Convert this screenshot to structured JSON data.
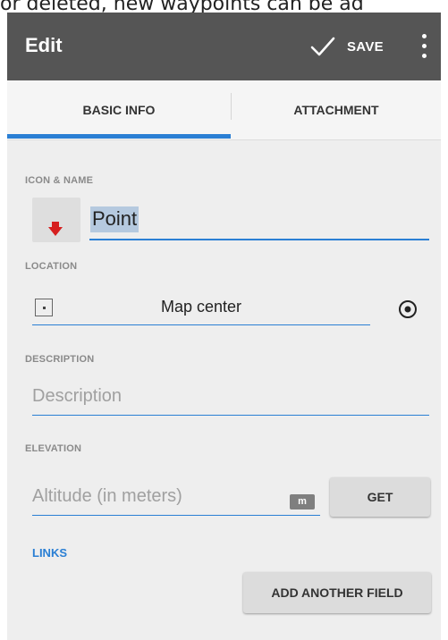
{
  "caption": "or deleted, new waypoints can be ad",
  "toolbar": {
    "title": "Edit",
    "save_label": "SAVE"
  },
  "tabs": [
    {
      "label": "BASIC INFO",
      "active": true
    },
    {
      "label": "ATTACHMENT",
      "active": false
    }
  ],
  "form": {
    "icon_name_label": "ICON & NAME",
    "name_value": "Point",
    "location_label": "LOCATION",
    "location_value": "Map center",
    "description_label": "DESCRIPTION",
    "description_placeholder": "Description",
    "elevation_label": "ELEVATION",
    "elevation_placeholder": "Altitude (in meters)",
    "elevation_unit": "m",
    "get_label": "GET",
    "links_label": "LINKS",
    "add_field_label": "ADD ANOTHER FIELD"
  },
  "colors": {
    "toolbar": "#555555",
    "accent": "#2a7fd4",
    "background": "#eeeeee",
    "waypoint_icon": "#d61f1f"
  },
  "icons": [
    "checkmark-icon",
    "overflow-menu-icon",
    "waypoint-arrow-icon",
    "location-square-icon",
    "target-icon"
  ]
}
